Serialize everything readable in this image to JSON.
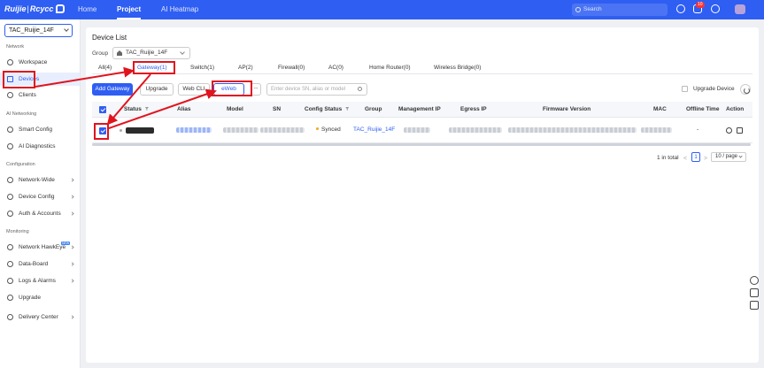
{
  "topbar": {
    "logo_left": "Ruijie",
    "logo_sep": "|",
    "logo_right": "Rcycc",
    "nav": [
      {
        "label": "Home"
      },
      {
        "label": "Project"
      },
      {
        "label": "AI Heatmap"
      }
    ],
    "search_placeholder": "Search",
    "notification_count": "10"
  },
  "sidebar": {
    "site": "TAC_Ruijie_14F",
    "sections": {
      "network": "Network",
      "ai_networking": "AI Networking",
      "configuration": "Configuration",
      "monitoring": "Monitoring"
    },
    "items": [
      {
        "label": "Workspace"
      },
      {
        "label": "Devices"
      },
      {
        "label": "Clients"
      },
      {
        "label": "Smart Config"
      },
      {
        "label": "AI Diagnostics"
      },
      {
        "label": "Network-Wide"
      },
      {
        "label": "Device Config"
      },
      {
        "label": "Auth & Accounts"
      },
      {
        "label": "Network HawkEye",
        "badge": "NEW"
      },
      {
        "label": "Data-Board"
      },
      {
        "label": "Logs & Alarms"
      },
      {
        "label": "Upgrade"
      },
      {
        "label": "Delivery Center"
      }
    ]
  },
  "main": {
    "title": "Device List",
    "group_label": "Group",
    "group_value": "TAC_Ruijie_14F",
    "tabs": [
      {
        "label": "All(4)"
      },
      {
        "label": "Gateway(1)"
      },
      {
        "label": "Switch(1)"
      },
      {
        "label": "AP(2)"
      },
      {
        "label": "Firewall(0)"
      },
      {
        "label": "AC(0)"
      },
      {
        "label": "Home Router(0)"
      },
      {
        "label": "Wireless Bridge(0)"
      }
    ],
    "toolbar": {
      "add": "Add Gateway",
      "upgrade": "Upgrade",
      "webcli": "Web CLI",
      "eweb": "eWeb",
      "more": "...",
      "search_placeholder": "Enter device SN, alias or model",
      "upgrade_device": "Upgrade Device"
    },
    "table": {
      "headers": [
        "Status",
        "Alias",
        "Model",
        "SN",
        "Config Status",
        "Group",
        "Management IP",
        "Egress IP",
        "Firmware Version",
        "MAC",
        "Offline Time",
        "Action"
      ],
      "row": {
        "config_status": "Synced",
        "group": "TAC_Ruijie_14F",
        "offline_time": "-"
      }
    },
    "pagination": {
      "total": "1 in total",
      "prev": "<",
      "page": "1",
      "next": ">",
      "page_size": "10 / page"
    }
  },
  "colors": {
    "brand": "#2f5ef2",
    "annotation": "#e0141e"
  }
}
